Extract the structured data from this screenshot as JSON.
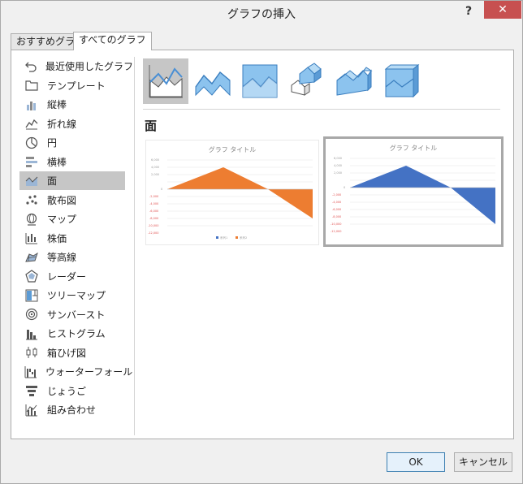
{
  "window": {
    "title": "グラフの挿入",
    "help_label": "?",
    "close_label": "✕"
  },
  "tabs": [
    {
      "label": "おすすめグラフ",
      "active": false
    },
    {
      "label": "すべてのグラフ",
      "active": true
    }
  ],
  "sidebar": {
    "items": [
      {
        "label": "最近使用したグラフ",
        "icon": "undo-arrow-icon"
      },
      {
        "label": "テンプレート",
        "icon": "folder-icon"
      },
      {
        "label": "縦棒",
        "icon": "column-chart-icon"
      },
      {
        "label": "折れ線",
        "icon": "line-chart-icon"
      },
      {
        "label": "円",
        "icon": "pie-chart-icon"
      },
      {
        "label": "横棒",
        "icon": "bar-chart-icon"
      },
      {
        "label": "面",
        "icon": "area-chart-icon",
        "selected": true
      },
      {
        "label": "散布図",
        "icon": "scatter-chart-icon"
      },
      {
        "label": "マップ",
        "icon": "map-globe-icon"
      },
      {
        "label": "株価",
        "icon": "stock-chart-icon"
      },
      {
        "label": "等高線",
        "icon": "surface-chart-icon"
      },
      {
        "label": "レーダー",
        "icon": "radar-chart-icon"
      },
      {
        "label": "ツリーマップ",
        "icon": "treemap-chart-icon"
      },
      {
        "label": "サンバースト",
        "icon": "sunburst-chart-icon"
      },
      {
        "label": "ヒストグラム",
        "icon": "histogram-chart-icon"
      },
      {
        "label": "箱ひげ図",
        "icon": "box-whisker-chart-icon"
      },
      {
        "label": "ウォーターフォール",
        "icon": "waterfall-chart-icon"
      },
      {
        "label": "じょうご",
        "icon": "funnel-chart-icon"
      },
      {
        "label": "組み合わせ",
        "icon": "combo-chart-icon"
      }
    ]
  },
  "chart_types": [
    {
      "name": "area",
      "selected": true
    },
    {
      "name": "stacked-area"
    },
    {
      "name": "100-percent-stacked-area"
    },
    {
      "name": "3d-area"
    },
    {
      "name": "3d-stacked-area"
    },
    {
      "name": "3d-100-percent-stacked-area"
    }
  ],
  "section": {
    "title": "面"
  },
  "previews": [
    {
      "title": "グラフ タイトル",
      "fill": "#ed7d31"
    },
    {
      "title": "グラフ タイトル",
      "fill": "#4472c4"
    }
  ],
  "buttons": {
    "ok": "OK",
    "cancel": "キャンセル"
  }
}
